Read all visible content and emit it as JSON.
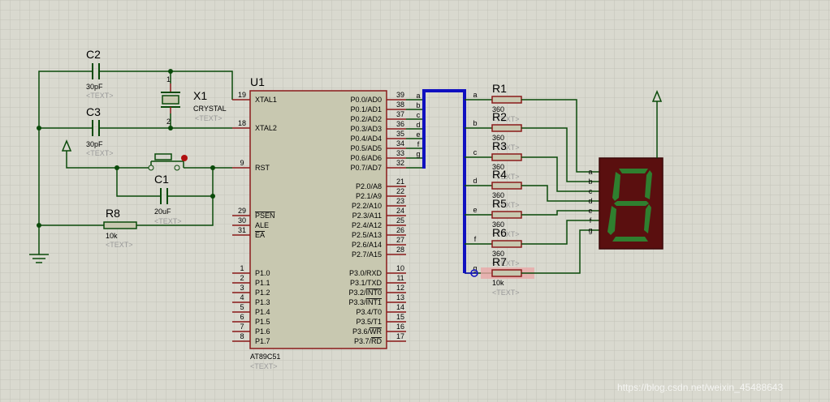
{
  "schematic": {
    "colors": {
      "background": "#d9d9cf",
      "grid": "#c4c4b8",
      "wire": "#0a4a0a",
      "pin": "#8b1a1a",
      "chip_body": "#c8c8b0",
      "chip_border": "#8b1a1a",
      "bus": "#1010c0",
      "display_body": "#5a0f0f",
      "segment_on": "#2f7f2f",
      "highlight": "#e8a8a8"
    },
    "chip": {
      "ref": "U1",
      "part": "AT89C51",
      "text": "<TEXT>",
      "left_pins": [
        {
          "num": "19",
          "name": "XTAL1"
        },
        {
          "num": "18",
          "name": "XTAL2"
        },
        {
          "num": "9",
          "name": "RST"
        },
        {
          "num": "29",
          "name": "PSEN"
        },
        {
          "num": "30",
          "name": "ALE"
        },
        {
          "num": "31",
          "name": "EA"
        },
        {
          "num": "1",
          "name": "P1.0"
        },
        {
          "num": "2",
          "name": "P1.1"
        },
        {
          "num": "3",
          "name": "P1.2"
        },
        {
          "num": "4",
          "name": "P1.3"
        },
        {
          "num": "5",
          "name": "P1.4"
        },
        {
          "num": "6",
          "name": "P1.5"
        },
        {
          "num": "7",
          "name": "P1.6"
        },
        {
          "num": "8",
          "name": "P1.7"
        }
      ],
      "right_pins": [
        {
          "num": "39",
          "name": "P0.0/AD0",
          "net": "a"
        },
        {
          "num": "38",
          "name": "P0.1/AD1",
          "net": "b"
        },
        {
          "num": "37",
          "name": "P0.2/AD2",
          "net": "c"
        },
        {
          "num": "36",
          "name": "P0.3/AD3",
          "net": "d"
        },
        {
          "num": "35",
          "name": "P0.4/AD4",
          "net": "e"
        },
        {
          "num": "34",
          "name": "P0.5/AD5",
          "net": "f"
        },
        {
          "num": "33",
          "name": "P0.6/AD6",
          "net": "g"
        },
        {
          "num": "32",
          "name": "P0.7/AD7",
          "net": ""
        },
        {
          "num": "21",
          "name": "P2.0/A8"
        },
        {
          "num": "22",
          "name": "P2.1/A9"
        },
        {
          "num": "23",
          "name": "P2.2/A10"
        },
        {
          "num": "24",
          "name": "P2.3/A11"
        },
        {
          "num": "25",
          "name": "P2.4/A12"
        },
        {
          "num": "26",
          "name": "P2.5/A13"
        },
        {
          "num": "27",
          "name": "P2.6/A14"
        },
        {
          "num": "28",
          "name": "P2.7/A15"
        },
        {
          "num": "10",
          "name": "P3.0/RXD"
        },
        {
          "num": "11",
          "name": "P3.1/TXD"
        },
        {
          "num": "12",
          "name": "P3.2/INT0"
        },
        {
          "num": "13",
          "name": "P3.3/INT1"
        },
        {
          "num": "14",
          "name": "P3.4/T0"
        },
        {
          "num": "15",
          "name": "P3.5/T1"
        },
        {
          "num": "16",
          "name": "P3.6/WR"
        },
        {
          "num": "17",
          "name": "P3.7/RD"
        }
      ]
    },
    "components": {
      "c2": {
        "ref": "C2",
        "value": "30pF",
        "text": "<TEXT>"
      },
      "c3": {
        "ref": "C3",
        "value": "30pF",
        "text": "<TEXT>"
      },
      "x1": {
        "ref": "X1",
        "value": "CRYSTAL",
        "text": "<TEXT>",
        "pin1": "1",
        "pin2": "2"
      },
      "c1": {
        "ref": "C1",
        "value": "20uF",
        "text": "<TEXT>"
      },
      "r8": {
        "ref": "R8",
        "value": "10k",
        "text": "<TEXT>"
      }
    },
    "resistors": [
      {
        "ref": "R1",
        "value": "360",
        "text": "<TEXT>",
        "net": "a"
      },
      {
        "ref": "R2",
        "value": "360",
        "text": "<TEXT>",
        "net": "b"
      },
      {
        "ref": "R3",
        "value": "360",
        "text": "<TEXT>",
        "net": "c"
      },
      {
        "ref": "R4",
        "value": "360",
        "text": "<TEXT>",
        "net": "d"
      },
      {
        "ref": "R5",
        "value": "360",
        "text": "<TEXT>",
        "net": "e"
      },
      {
        "ref": "R6",
        "value": "360",
        "text": "<TEXT>",
        "net": "f"
      },
      {
        "ref": "R7",
        "value": "10k",
        "text": "<TEXT>",
        "net": "g"
      }
    ],
    "display": {
      "pins": [
        "a",
        "b",
        "c",
        "d",
        "e",
        "f",
        "g"
      ],
      "digit": "8"
    },
    "watermark": "https://blog.csdn.net/weixin_45488643"
  }
}
